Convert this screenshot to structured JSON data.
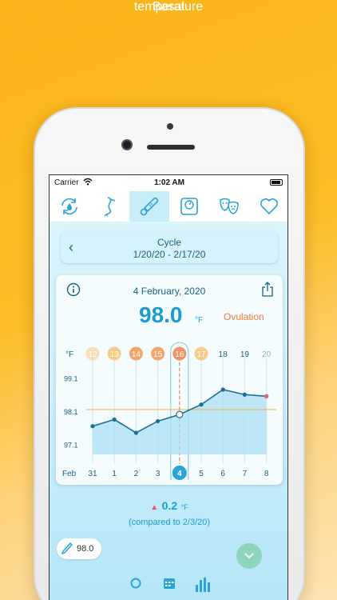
{
  "banner": {
    "line1": "Basal",
    "line2": "temperature"
  },
  "status_bar": {
    "carrier": "Carrier",
    "time": "1:02 AM"
  },
  "tabs": [
    {
      "icon": "cycle-drop-icon",
      "active": false
    },
    {
      "icon": "stork-icon",
      "active": false
    },
    {
      "icon": "thermometer-icon",
      "active": true
    },
    {
      "icon": "scale-icon",
      "active": false
    },
    {
      "icon": "mood-masks-icon",
      "active": false
    },
    {
      "icon": "heart-icon",
      "active": false
    }
  ],
  "cycle": {
    "title": "Cycle",
    "range": "1/20/20 - 2/17/20"
  },
  "card": {
    "date": "4 February, 2020",
    "temperature": "98.0",
    "unit": "°F",
    "phase": "Ovulation"
  },
  "chart_data": {
    "type": "line",
    "unit_label": "°F",
    "month_label": "Feb",
    "cycle_days": [
      "12",
      "13",
      "14",
      "15",
      "16",
      "17",
      "18",
      "19",
      "20"
    ],
    "cycle_day_styles": [
      "fertile",
      "fertile",
      "fertile-high",
      "fertile-high",
      "ovulation",
      "fertile",
      "plain",
      "plain",
      "plain"
    ],
    "dates": [
      "31",
      "1",
      "2",
      "3",
      "4",
      "5",
      "6",
      "7",
      "8"
    ],
    "selected_index": 4,
    "x": [
      0,
      1,
      2,
      3,
      4,
      5,
      6,
      7,
      8
    ],
    "values": [
      97.65,
      97.85,
      97.45,
      97.8,
      98.0,
      98.3,
      98.75,
      98.6,
      98.55
    ],
    "yticks": [
      "99.1",
      "98.1",
      "97.1"
    ],
    "ytick_values": [
      99.1,
      98.1,
      97.1
    ],
    "ylim": [
      96.8,
      99.4
    ],
    "coverline": 98.15,
    "colors": {
      "line": "#1b6f94",
      "fill": "#a9dff3",
      "coverline": "#f3b64a",
      "fertile": "#f7c77b",
      "fertile_high": "#f29a5a",
      "ovulation": "#f2865a",
      "selected": "#2aa3d8",
      "last_point": "#d96a8a"
    }
  },
  "delta": {
    "value": "0.2",
    "unit": "°F",
    "note": "(compared to 2/3/20)"
  },
  "entry": {
    "value": "98.0"
  },
  "bottom_tabs": [
    {
      "icon": "ring-icon"
    },
    {
      "icon": "calendar-icon"
    },
    {
      "icon": "bar-chart-icon"
    }
  ]
}
